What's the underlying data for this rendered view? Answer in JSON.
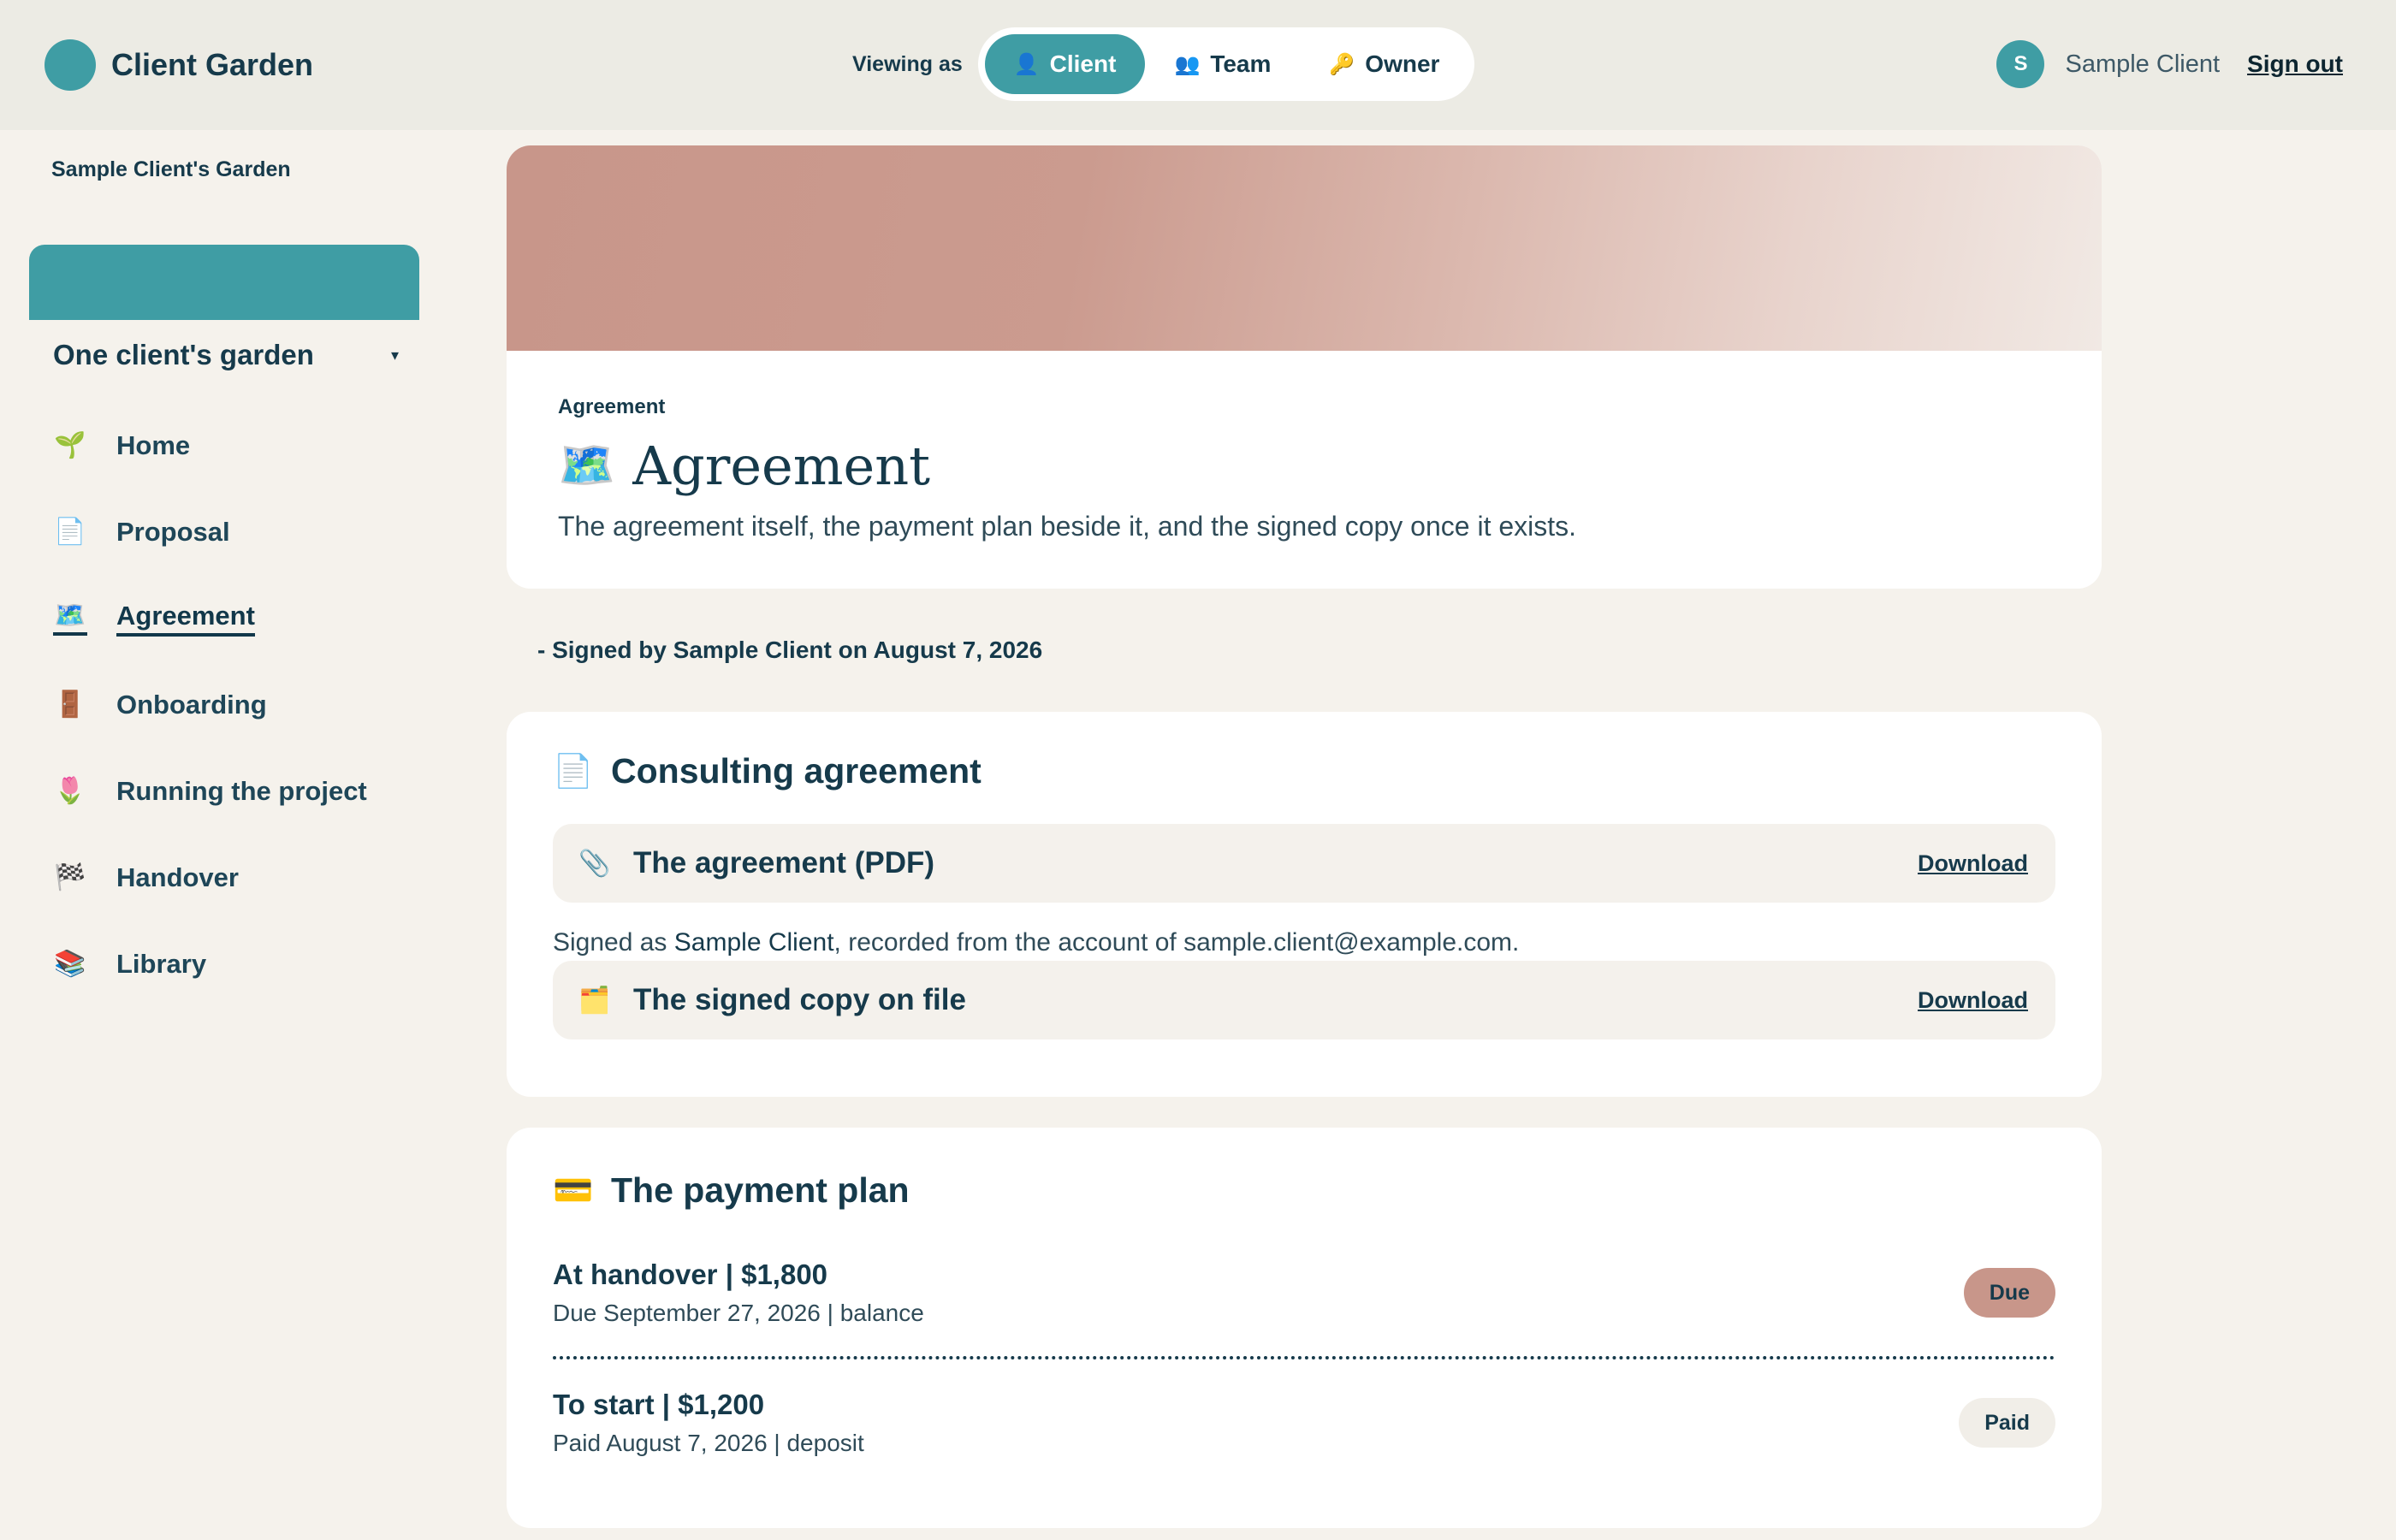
{
  "app": {
    "name": "Client Garden"
  },
  "header": {
    "viewing_label": "Viewing as",
    "roles": [
      {
        "icon": "👤",
        "label": "Client"
      },
      {
        "icon": "👥",
        "label": "Team"
      },
      {
        "icon": "🔑",
        "label": "Owner"
      }
    ],
    "active_role": "Client",
    "user": {
      "initial": "S",
      "name": "Sample Client"
    },
    "sign_out": "Sign out"
  },
  "sidebar": {
    "garden_title": "Sample Client's Garden",
    "switcher_label": "One client's garden",
    "caret": "▾",
    "items": [
      {
        "icon": "🌱",
        "label": "Home"
      },
      {
        "icon": "📄",
        "label": "Proposal"
      },
      {
        "icon": "🗺️",
        "label": "Agreement"
      },
      {
        "icon": "🚪",
        "label": "Onboarding"
      },
      {
        "icon": "🌷",
        "label": "Running the project"
      },
      {
        "icon": "🏁",
        "label": "Handover"
      },
      {
        "icon": "📚",
        "label": "Library"
      }
    ],
    "active_item": "Agreement"
  },
  "hero": {
    "eyebrow": "Agreement",
    "icon": "🗺️",
    "title": "Agreement",
    "description": "The agreement itself, the payment plan beside it, and the signed copy once it exists."
  },
  "signed_note": "- Signed by Sample Client on August 7, 2026",
  "agreement": {
    "icon": "📄",
    "title": "Consulting agreement",
    "files": [
      {
        "icon": "📎",
        "label": "The agreement (PDF)",
        "action": "Download"
      },
      {
        "icon": "🗂️",
        "label": "The signed copy on file",
        "action": "Download"
      }
    ],
    "signed_line": {
      "prefix": "Signed as ",
      "name": "Sample Client",
      "suffix": ", recorded from the account of sample.client@example.com."
    }
  },
  "payment": {
    "icon": "💳",
    "title": "The payment plan",
    "rows": [
      {
        "title": "At handover | $1,800",
        "sub": "Due September 27, 2026 | balance",
        "status": "Due"
      },
      {
        "title": "To start | $1,200",
        "sub": "Paid August 7, 2026 | deposit",
        "status": "Paid"
      }
    ]
  }
}
